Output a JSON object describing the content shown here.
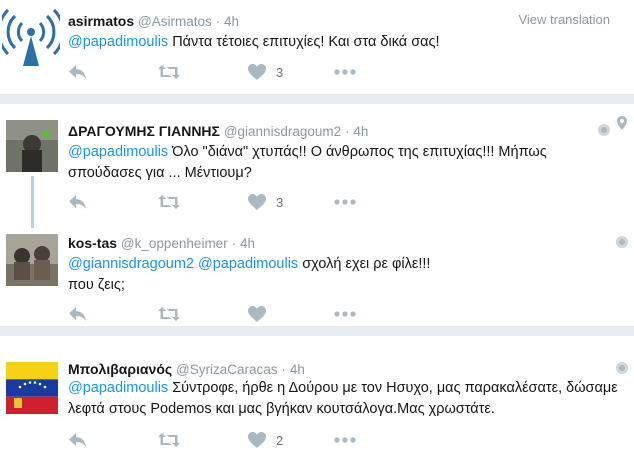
{
  "tweets": [
    {
      "fullname": "asirmatos",
      "handle": "@Asirmatos",
      "dot": "·",
      "time": "4h",
      "translate": "View translation",
      "mentions": [
        "@papadimoulis"
      ],
      "text": " Πάντα τέτοιες επιτυχίες! Και στα δικά σας!",
      "likes": "3"
    },
    {
      "fullname": "ΔΡΑΓΟΥΜΗΣ ΓΙΑΝΝΗΣ",
      "handle": "@giannisdragoum2",
      "dot": "·",
      "time": "4h",
      "mentions": [
        "@papadimoulis"
      ],
      "text": " Όλο \"διάνα\" χτυπάς!! Ο άνθρωπος της επιτυχίας!!! Μήπως σπούδασες για ... Μέντιουμ?",
      "likes": "3"
    },
    {
      "fullname": "kos-tas",
      "handle": "@k_oppenheimer",
      "dot": "·",
      "time": "4h",
      "mentions": [
        "@giannisdragoum2",
        "@papadimoulis"
      ],
      "text": " σχολή εχει ρε φίλε!!!",
      "text2": "που ζεις;",
      "likes": ""
    },
    {
      "fullname": "Μπολιβαριανός",
      "handle": "@SyrizaCaracas",
      "dot": "·",
      "time": "4h",
      "mentions": [
        "@papadimoulis"
      ],
      "text": " Σύντροφε, ήρθε η Δούρου με τον Ησυχο, μας παρακαλέσατε, δώσαμε λεφτά στους Podemos και μας βγήκαν κουτσάλογα.Μας χρωστάτε.",
      "likes": "2"
    }
  ],
  "colors": {
    "link": "#1b95e0",
    "muted": "#8899a6",
    "background": "#e6ecf0",
    "thread": "#a9d4f0"
  },
  "icons": [
    "broadcast-antenna-avatar",
    "reply-icon",
    "retweet-icon",
    "heart-icon",
    "more-icon",
    "globe-icon",
    "location-pin-icon",
    "venezuela-flag-avatar"
  ]
}
